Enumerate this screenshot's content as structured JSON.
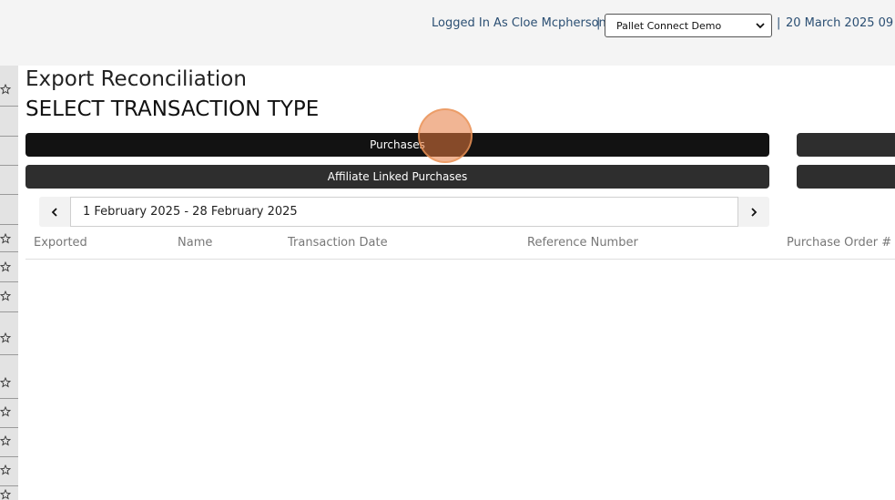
{
  "header": {
    "logged_in_text": "Logged In As Cloe Mcpherson",
    "separator": "|",
    "company_selected": "Pallet Connect Demo",
    "date_text": "20 March 2025 09"
  },
  "page": {
    "title": "Export Reconciliation",
    "subtitle": "SELECT TRANSACTION TYPE"
  },
  "transaction_types": {
    "purchases": "Purchases",
    "affiliate_linked_purchases": "Affiliate Linked Purchases"
  },
  "date_range": {
    "value": "1 February 2025 - 28 February 2025"
  },
  "table": {
    "columns": [
      "Exported",
      "Name",
      "Transaction Date",
      "Reference Number",
      "Purchase Order #"
    ]
  },
  "icons": {
    "star": "star-outline-icon",
    "prev": "chevron-left-icon",
    "next": "chevron-right-icon",
    "dropdown": "chevron-down-icon"
  },
  "colors": {
    "accent_text": "#2b4f73",
    "button_primary": "#121212",
    "button_secondary": "#2e2e2e"
  }
}
